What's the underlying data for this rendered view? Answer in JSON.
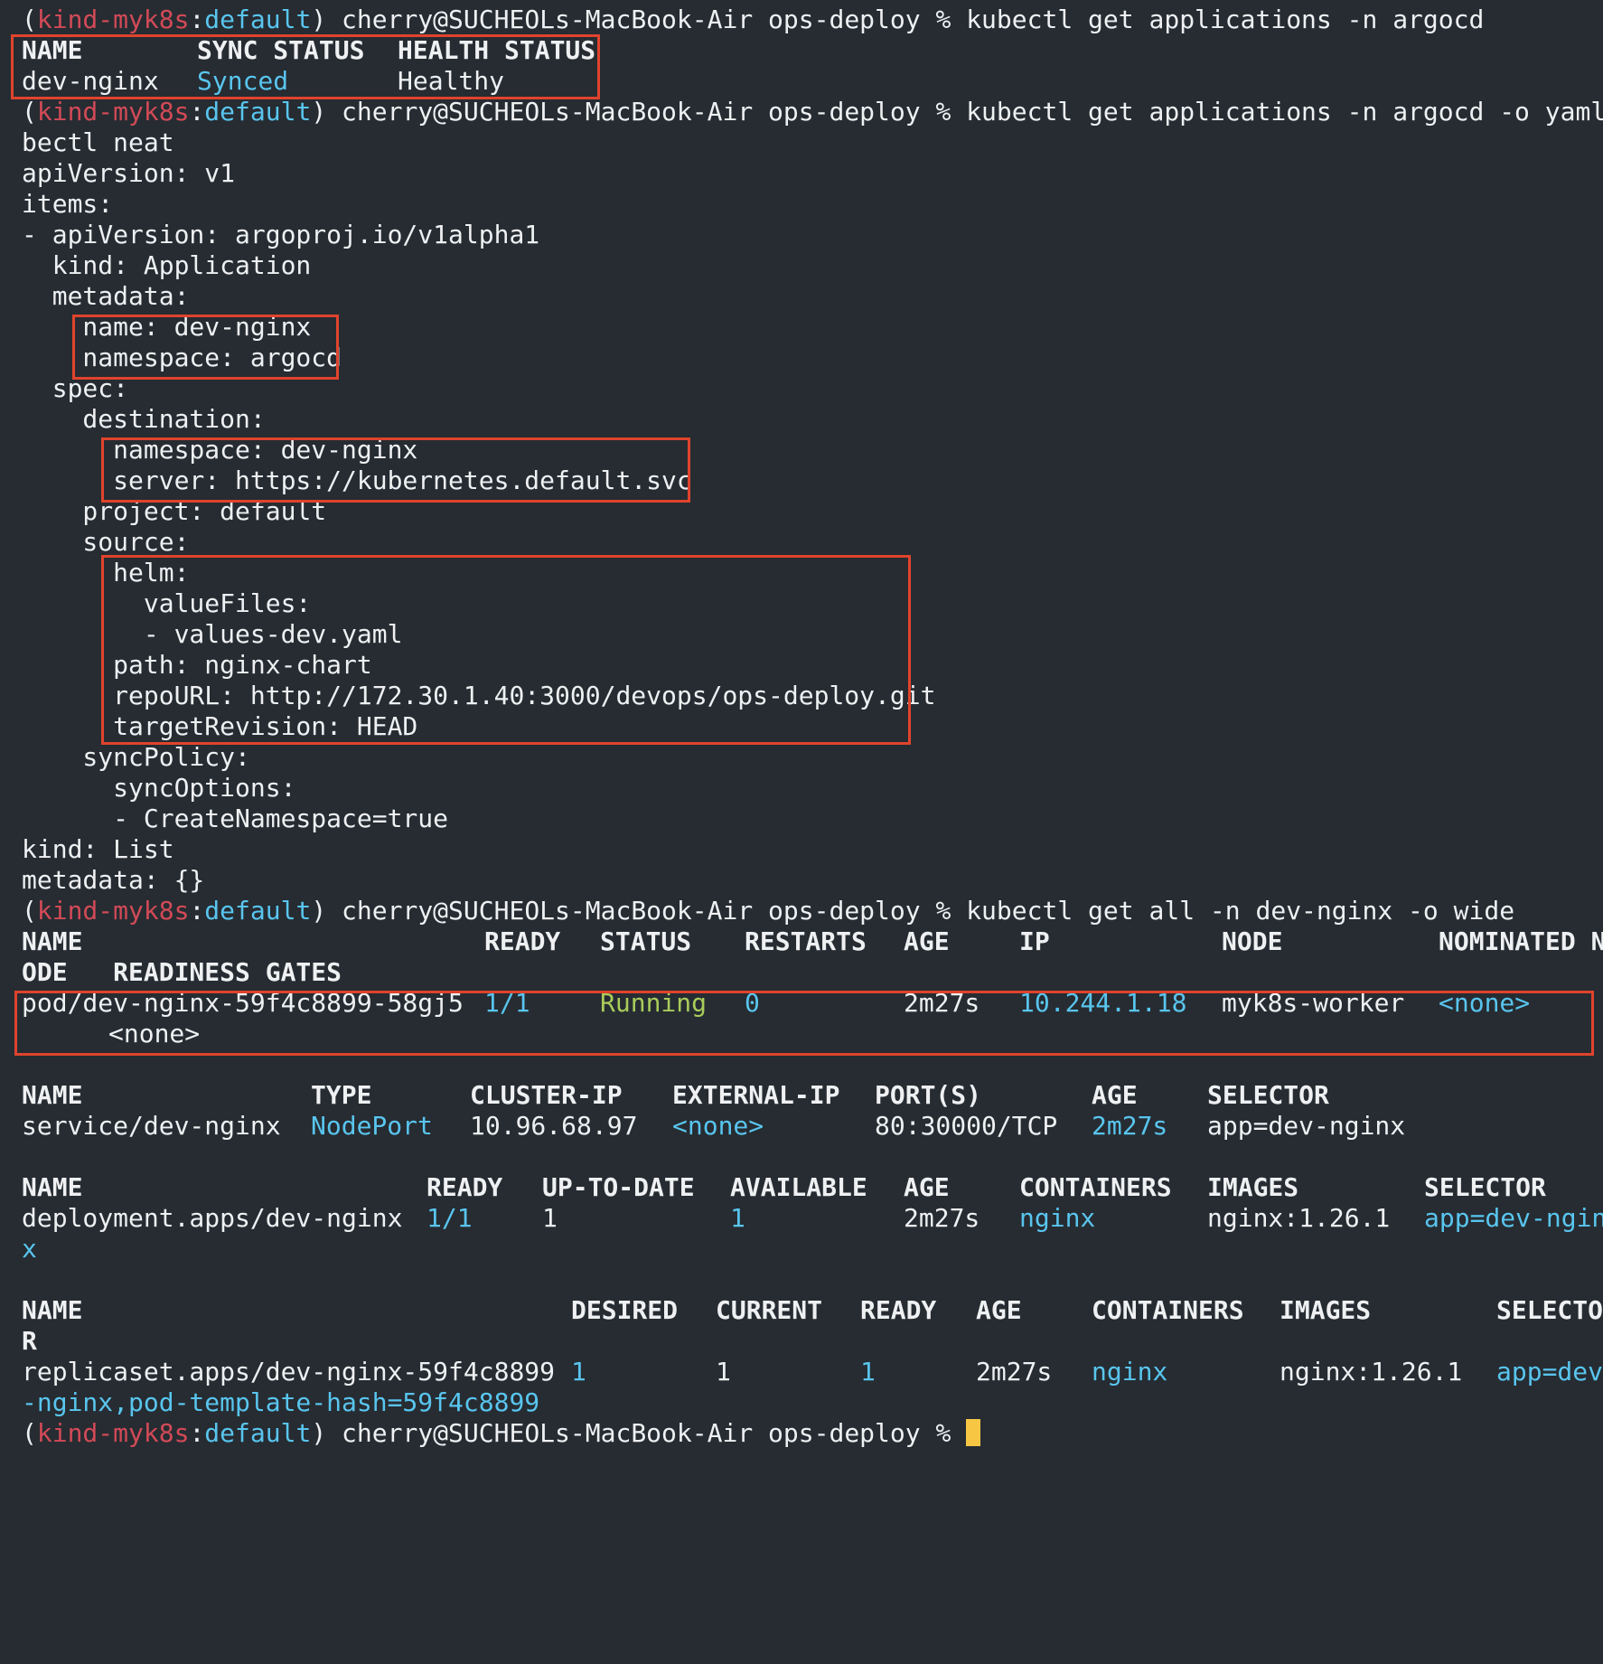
{
  "prompt": {
    "open": "(",
    "cluster": "kind-myk8s",
    "sep": ":",
    "ns": "default",
    "close": ")",
    "user_dir": " cherry@SUCHEOLs-MacBook-Air ops-deploy % "
  },
  "commands": {
    "get_apps": "kubectl get applications -n argocd",
    "get_apps_yaml_1": "kubectl get applications -n argocd -o yaml | ku",
    "get_apps_yaml_2": "bectl neat",
    "get_all": "kubectl get all -n dev-nginx -o wide"
  },
  "apps_table": {
    "headers": [
      "NAME",
      "SYNC STATUS",
      "HEALTH STATUS"
    ],
    "row": [
      "dev-nginx",
      "Synced",
      "Healthy"
    ]
  },
  "yaml_lines": [
    "apiVersion: v1",
    "items:",
    "- apiVersion: argoproj.io/v1alpha1",
    "  kind: Application",
    "  metadata:",
    "    name: dev-nginx",
    "    namespace: argocd",
    "  spec:",
    "    destination:",
    "      namespace: dev-nginx",
    "      server: https://kubernetes.default.svc",
    "    project: default",
    "    source:",
    "      helm:",
    "        valueFiles:",
    "        - values-dev.yaml",
    "      path: nginx-chart",
    "      repoURL: http://172.30.1.40:3000/devops/ops-deploy.git",
    "      targetRevision: HEAD",
    "    syncPolicy:",
    "      syncOptions:",
    "      - CreateNamespace=true",
    "kind: List",
    "metadata: {}"
  ],
  "pods": {
    "headers": [
      "NAME",
      "READY",
      "STATUS",
      "RESTARTS",
      "AGE",
      "IP",
      "NODE",
      "NOMINATED N"
    ],
    "headers_wrap": "ODE   READINESS GATES",
    "row": [
      "pod/dev-nginx-59f4c8899-58gj5",
      "1/1",
      "Running",
      "0",
      "2m27s",
      "10.244.1.18",
      "myk8s-worker",
      "<none>"
    ],
    "row_wrap": "<none>"
  },
  "services": {
    "headers": [
      "NAME",
      "TYPE",
      "CLUSTER-IP",
      "EXTERNAL-IP",
      "PORT(S)",
      "AGE",
      "SELECTOR"
    ],
    "row": [
      "service/dev-nginx",
      "NodePort",
      "10.96.68.97",
      "<none>",
      "80:30000/TCP",
      "2m27s",
      "app=dev-nginx"
    ]
  },
  "deployments": {
    "headers": [
      "NAME",
      "READY",
      "UP-TO-DATE",
      "AVAILABLE",
      "AGE",
      "CONTAINERS",
      "IMAGES",
      "SELECTOR"
    ],
    "row": [
      "deployment.apps/dev-nginx",
      "1/1",
      "1",
      "1",
      "2m27s",
      "nginx",
      "nginx:1.26.1",
      "app=dev-ngin"
    ],
    "row_wrap": "x"
  },
  "replicasets": {
    "headers": [
      "NAME",
      "DESIRED",
      "CURRENT",
      "READY",
      "AGE",
      "CONTAINERS",
      "IMAGES",
      "SELECTO"
    ],
    "headers_wrap": "R",
    "row": [
      "replicaset.apps/dev-nginx-59f4c8899",
      "1",
      "1",
      "1",
      "2m27s",
      "nginx",
      "nginx:1.26.1",
      "app=dev"
    ],
    "row_wrap": "-nginx,pod-template-hash=59f4c8899"
  },
  "colors": {
    "background": "#262c32",
    "text": "#eef0f2",
    "prompt_cluster": "#d24a57",
    "prompt_namespace": "#59c5ee",
    "value_blue": "#59c5ee",
    "value_green": "#a9cc5a",
    "highlight_box": "#e0432d",
    "cursor": "#f7c744"
  }
}
